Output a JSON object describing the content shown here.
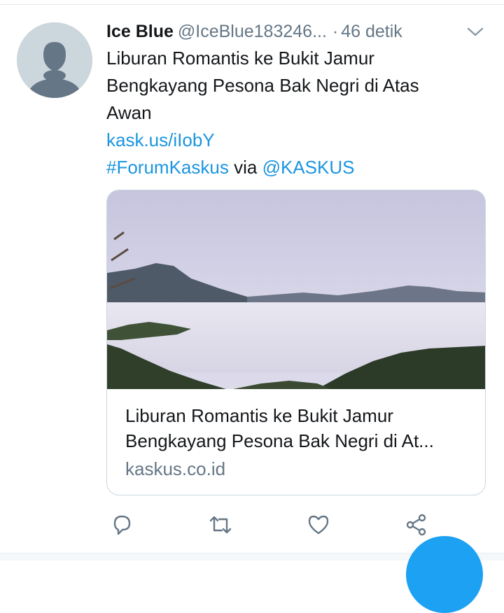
{
  "tweet": {
    "author_name": "Ice Blue",
    "author_handle": "@IceBlue183246...",
    "separator": "·",
    "timestamp": "46 detik",
    "text_lines": [
      "Liburan Romantis ke Bukit Jamur",
      "Bengkayang Pesona Bak Negri di Atas",
      "Awan"
    ],
    "short_link": "kask.us/iIobY",
    "hashtag": "#ForumKaskus",
    "via_text": "via",
    "mention": "@KASKUS"
  },
  "card": {
    "title_line_1": "Liburan Romantis ke Bukit Jamur",
    "title_line_2": "Bengkayang Pesona Bak Negri di At...",
    "domain": "kaskus.co.id",
    "image_icon": "landscape-photo"
  },
  "actions": {
    "reply_icon": "reply-icon",
    "retweet_icon": "retweet-icon",
    "like_icon": "heart-icon",
    "share_icon": "share-icon"
  },
  "colors": {
    "link": "#1b95e0",
    "text": "#14171a",
    "secondary": "#657786",
    "border": "#ccd6dd",
    "accent": "#1da1f2"
  }
}
